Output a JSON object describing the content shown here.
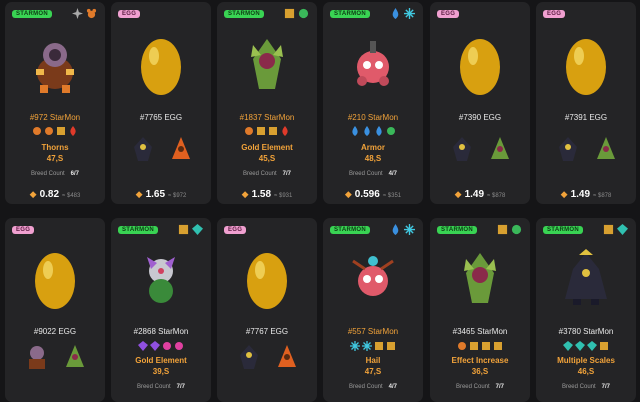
{
  "cards": [
    {
      "type": "StarMon",
      "badge": "STARMON",
      "title": "#972 StarMon",
      "ability": "Thorns",
      "speed": "47,S",
      "breed_label": "Breed Count",
      "breed_value": "6/7",
      "price": "0.82",
      "usd": "≈ $483",
      "elements": [
        "star-icon",
        "beast-icon"
      ]
    },
    {
      "type": "Egg",
      "badge": "EGG",
      "title": "#7765 EGG",
      "price": "1.65",
      "usd": "≈ $972"
    },
    {
      "type": "StarMon",
      "badge": "STARMON",
      "title": "#1837 StarMon",
      "ability": "Gold Element",
      "speed": "45,S",
      "breed_label": "Breed Count",
      "breed_value": "7/7",
      "price": "1.58",
      "usd": "≈ $931",
      "elements": [
        "cube-icon",
        "leaf-icon"
      ]
    },
    {
      "type": "StarMon",
      "badge": "STARMON",
      "title": "#210 StarMon",
      "ability": "Armor",
      "speed": "48,S",
      "breed_label": "Breed Count",
      "breed_value": "4/7",
      "price": "0.596",
      "usd": "≈ $351",
      "elements": [
        "water-icon",
        "snow-icon"
      ]
    },
    {
      "type": "Egg",
      "badge": "EGG",
      "title": "#7390 EGG",
      "price": "1.49",
      "usd": "≈ $878"
    },
    {
      "type": "Egg",
      "badge": "EGG",
      "title": "#7391 EGG",
      "price": "1.49",
      "usd": "≈ $878"
    },
    {
      "type": "Egg",
      "badge": "EGG",
      "title": "#9022 EGG"
    },
    {
      "type": "StarMon",
      "badge": "STARMON",
      "title": "#2868 StarMon",
      "ability": "Gold Element",
      "speed": "39,S",
      "breed_label": "Breed Count",
      "breed_value": "7/7",
      "elements": [
        "cube-icon",
        "gem-icon"
      ]
    },
    {
      "type": "Egg",
      "badge": "EGG",
      "title": "#7767 EGG"
    },
    {
      "type": "StarMon",
      "badge": "STARMON",
      "title": "#557 StarMon",
      "ability": "Hail",
      "speed": "47,S",
      "breed_label": "Breed Count",
      "breed_value": "4/7",
      "elements": [
        "water-icon",
        "snow-icon"
      ]
    },
    {
      "type": "StarMon",
      "badge": "STARMON",
      "title": "#3465 StarMon",
      "ability": "Effect Increase",
      "speed": "36,S",
      "breed_label": "Breed Count",
      "breed_value": "7/7",
      "elements": [
        "cube-icon",
        "leaf-icon"
      ]
    },
    {
      "type": "StarMon",
      "badge": "STARMON",
      "title": "#3780 StarMon",
      "ability": "Multiple Scales",
      "speed": "46,S",
      "breed_label": "Breed Count",
      "breed_value": "7/7",
      "elements": [
        "cube-icon",
        "gem-icon"
      ]
    }
  ]
}
